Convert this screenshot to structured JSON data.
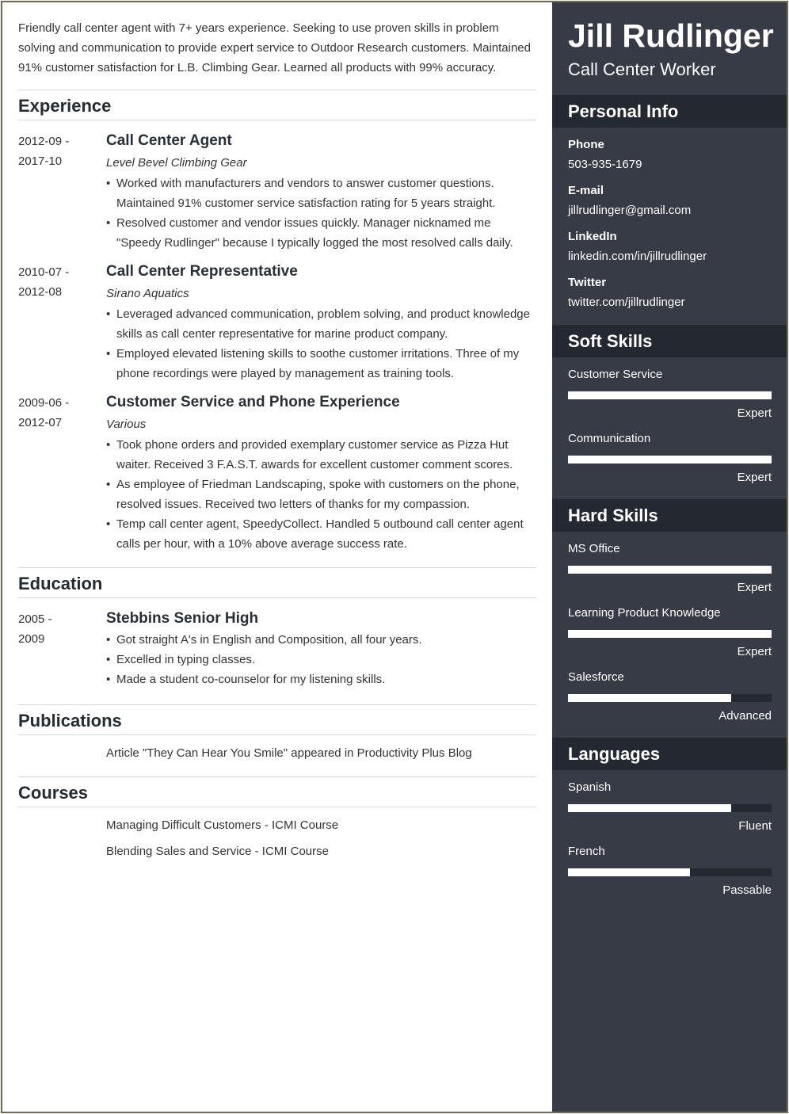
{
  "summary": "Friendly call center agent with 7+ years experience. Seeking to use proven skills in problem solving and communication to provide expert service to Outdoor Research customers. Maintained 91% customer satisfaction for L.B. Climbing Gear. Learned all products with 99% accuracy.",
  "experience": {
    "heading": "Experience",
    "entries": [
      {
        "date_start": "2012-09 -",
        "date_end": "2017-10",
        "title": "Call Center Agent",
        "company": "Level Bevel Climbing Gear",
        "bullets": [
          "Worked with manufacturers and vendors to answer customer questions. Maintained 91% customer service satisfaction rating for 5 years straight.",
          "Resolved customer and vendor issues quickly. Manager nicknamed me \"Speedy Rudlinger\" because I typically logged the most resolved calls daily."
        ]
      },
      {
        "date_start": "2010-07 -",
        "date_end": "2012-08",
        "title": "Call Center Representative",
        "company": "Sirano Aquatics",
        "bullets": [
          "Leveraged advanced communication, problem solving, and product knowledge skills as call center representative for marine product company.",
          "Employed elevated listening skills to soothe customer irritations. Three of my phone recordings were played by management as training tools."
        ]
      },
      {
        "date_start": "2009-06 -",
        "date_end": "2012-07",
        "title": "Customer Service and Phone Experience",
        "company": "Various",
        "bullets": [
          "Took phone orders and provided exemplary customer service as Pizza Hut waiter. Received 3 F.A.S.T. awards for excellent customer comment scores.",
          "As employee of Friedman Landscaping, spoke with customers on the phone, resolved issues. Received two letters of thanks for my compassion.",
          "Temp call center agent, SpeedyCollect. Handled 5 outbound call center agent calls per hour, with a 10% above average success rate."
        ]
      }
    ]
  },
  "education": {
    "heading": "Education",
    "entries": [
      {
        "date_start": "2005 -",
        "date_end": "2009",
        "title": "Stebbins Senior High",
        "bullets": [
          "Got straight A's in English and Composition, all four years.",
          "Excelled in typing classes.",
          "Made a student co-counselor for my listening skills."
        ]
      }
    ]
  },
  "publications": {
    "heading": "Publications",
    "items": [
      "Article \"They Can Hear You Smile\" appeared in Productivity Plus Blog"
    ]
  },
  "courses": {
    "heading": "Courses",
    "items": [
      "Managing Difficult Customers - ICMI Course",
      "Blending Sales and Service - ICMI Course"
    ]
  },
  "sidebar": {
    "name": "Jill Rudlinger",
    "role": "Call Center Worker",
    "personal_info": {
      "heading": "Personal Info",
      "items": [
        {
          "label": "Phone",
          "value": "503-935-1679"
        },
        {
          "label": "E-mail",
          "value": "jillrudlinger@gmail.com"
        },
        {
          "label": "LinkedIn",
          "value": "linkedin.com/in/jillrudlinger"
        },
        {
          "label": "Twitter",
          "value": "twitter.com/jillrudlinger"
        }
      ]
    },
    "soft_skills": {
      "heading": "Soft Skills",
      "items": [
        {
          "name": "Customer Service",
          "level": "Expert",
          "fill": 1.0
        },
        {
          "name": "Communication",
          "level": "Expert",
          "fill": 1.0
        }
      ]
    },
    "hard_skills": {
      "heading": "Hard Skills",
      "items": [
        {
          "name": "MS Office",
          "level": "Expert",
          "fill": 1.0
        },
        {
          "name": "Learning Product Knowledge",
          "level": "Expert",
          "fill": 1.0
        },
        {
          "name": "Salesforce",
          "level": "Advanced",
          "fill": 0.8
        }
      ]
    },
    "languages": {
      "heading": "Languages",
      "items": [
        {
          "name": "Spanish",
          "level": "Fluent",
          "fill": 0.8
        },
        {
          "name": "French",
          "level": "Passable",
          "fill": 0.6
        }
      ]
    }
  },
  "colors": {
    "sidebar_bg": "#363b46",
    "sidebar_header_bg": "#242830",
    "bar_fill": "#ffffff",
    "bar_track": "#242830",
    "heading_text": "#262a31",
    "body_text": "#333333"
  }
}
